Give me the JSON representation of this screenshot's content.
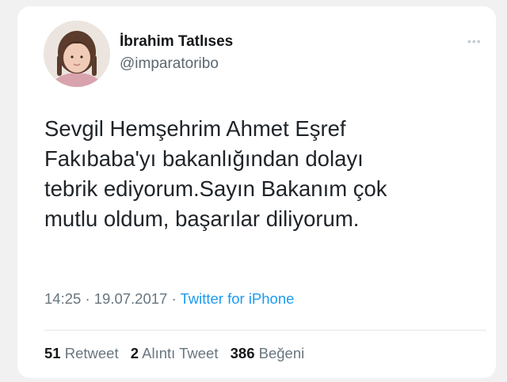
{
  "author": {
    "name": "İbrahim Tatlıses",
    "handle": "@imparatoribo",
    "avatar_icon": "profile-photo-child"
  },
  "menu_icon": "more-options-icon",
  "tweet": {
    "lines": [
      "Sevgil Hemşehrim Ahmet Eşref",
      "Fakıbaba'yı bakanlığından dolayı",
      "tebrik ediyorum.Sayın Bakanım çok",
      "mutlu oldum, başarılar diliyorum."
    ],
    "time": "14:25",
    "date": "19.07.2017",
    "separator": "·",
    "source": "Twitter for iPhone"
  },
  "stats": {
    "retweets_count": "51",
    "retweets_label": "Retweet",
    "quotes_count": "2",
    "quotes_label": "Alıntı Tweet",
    "likes_count": "386",
    "likes_label": "Beğeni"
  },
  "colors": {
    "link": "#1d9bf0",
    "text": "#1f2429",
    "secondary": "#687680"
  }
}
